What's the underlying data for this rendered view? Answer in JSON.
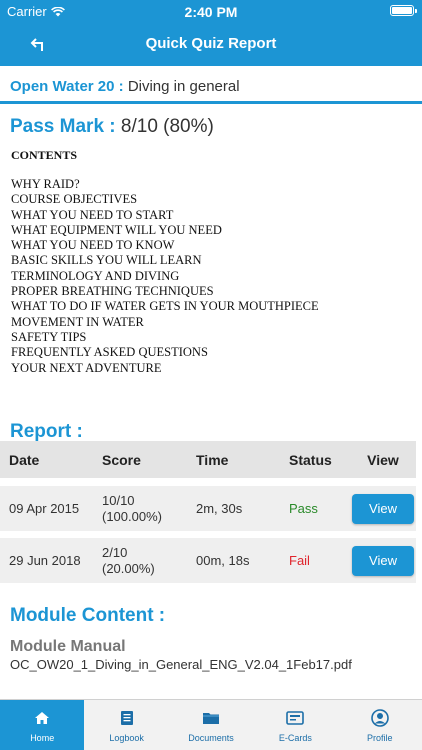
{
  "status_bar": {
    "carrier": "Carrier",
    "time": "2:40 PM"
  },
  "nav": {
    "title": "Quick Quiz Report",
    "back_icon": "back-arrow-icon"
  },
  "course": {
    "name": "Open Water 20 :",
    "topic": "Diving in general"
  },
  "pass_mark": {
    "label": "Pass Mark :",
    "value": "8/10 (80%)"
  },
  "contents": {
    "title": "CONTENTS",
    "items": [
      "WHY RAID?",
      "COURSE OBJECTIVES",
      "WHAT YOU NEED TO START",
      "WHAT EQUIPMENT WILL YOU NEED",
      "WHAT YOU NEED TO KNOW",
      "BASIC SKILLS YOU WILL LEARN",
      "TERMINOLOGY AND DIVING",
      "PROPER BREATHING TECHNIQUES",
      "WHAT TO DO IF WATER GETS IN YOUR MOUTHPIECE",
      "MOVEMENT IN WATER",
      "SAFETY TIPS",
      "FREQUENTLY ASKED QUESTIONS",
      "YOUR NEXT ADVENTURE"
    ]
  },
  "report": {
    "title": "Report :",
    "columns": [
      "Date",
      "Score",
      "Time",
      "Status",
      "View"
    ],
    "rows": [
      {
        "date": "09 Apr 2015",
        "score_line1": "10/10",
        "score_line2": "(100.00%)",
        "time": "2m, 30s",
        "status": "Pass",
        "view_label": "View"
      },
      {
        "date": "29 Jun 2018",
        "score_line1": "2/10",
        "score_line2": "(20.00%)",
        "time": "00m, 18s",
        "status": "Fail",
        "view_label": "View"
      }
    ]
  },
  "module": {
    "title": "Module Content :",
    "manual_label": "Module Manual",
    "manual_file": "OC_OW20_1_Diving_in_General_ENG_V2.04_1Feb17.pdf"
  },
  "tabs": [
    {
      "label": "Home",
      "icon": "home-icon"
    },
    {
      "label": "Logbook",
      "icon": "logbook-icon"
    },
    {
      "label": "Documents",
      "icon": "folder-icon"
    },
    {
      "label": "E-Cards",
      "icon": "ecard-icon"
    },
    {
      "label": "Profile",
      "icon": "profile-icon"
    }
  ],
  "colors": {
    "primary": "#1c95d4",
    "pass": "#2a8a2a",
    "fail": "#e0242c"
  }
}
